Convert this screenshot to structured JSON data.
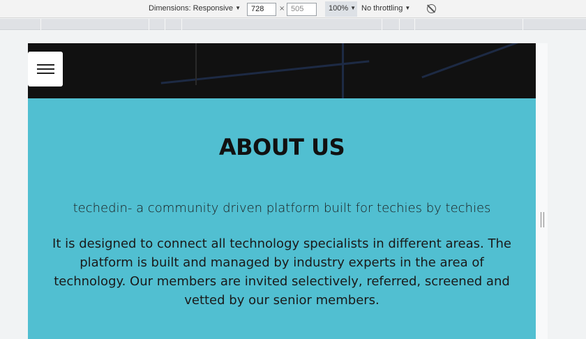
{
  "toolbar": {
    "dimensions_label": "Dimensions: Responsive",
    "width_value": "728",
    "height_placeholder": "505",
    "times": "×",
    "zoom": "100%",
    "throttling": "No throttling"
  },
  "page": {
    "title": "ABOUT US",
    "tagline": "techedin- a community driven platform built for techies by techies",
    "description": "It is designed to connect all technology specialists in different areas. The platform is built and managed by industry experts in the area of technology. Our members are invited selectively, referred, screened and vetted by our senior members."
  },
  "icons": {
    "menu": "hamburger-menu-icon",
    "rotate": "rotate-disabled-icon",
    "dropdown": "caret-down-icon"
  },
  "colors": {
    "section_bg": "#51bfd1",
    "hero_bg": "#111111"
  }
}
